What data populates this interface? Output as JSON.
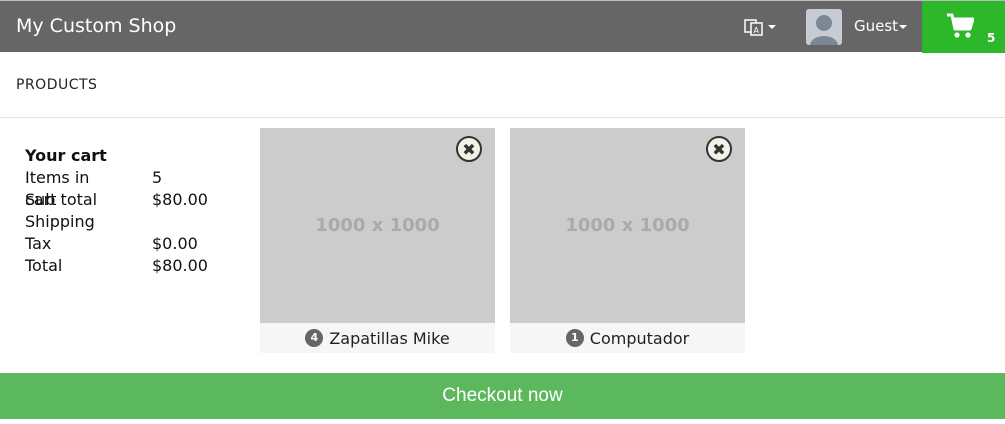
{
  "header": {
    "brand": "My Custom Shop",
    "user_label": "Guest",
    "cart_count": "5",
    "cart_color": "#2db72b",
    "bar_color": "#666666"
  },
  "nav": {
    "products": "PRODUCTS"
  },
  "summary": {
    "title": "Your cart",
    "rows": [
      {
        "label": "Items in cart",
        "value": "5"
      },
      {
        "label": "Sub total",
        "value": "$80.00"
      },
      {
        "label": "Shipping",
        "value": ""
      },
      {
        "label": "Tax",
        "value": "$0.00"
      },
      {
        "label": "Total",
        "value": "$80.00"
      }
    ]
  },
  "items": [
    {
      "placeholder": "1000 x 1000",
      "qty": "4",
      "name": "Zapatillas Mike"
    },
    {
      "placeholder": "1000 x 1000",
      "qty": "1",
      "name": "Computador"
    }
  ],
  "checkout": {
    "label": "Checkout now",
    "color": "#5cb85c"
  }
}
